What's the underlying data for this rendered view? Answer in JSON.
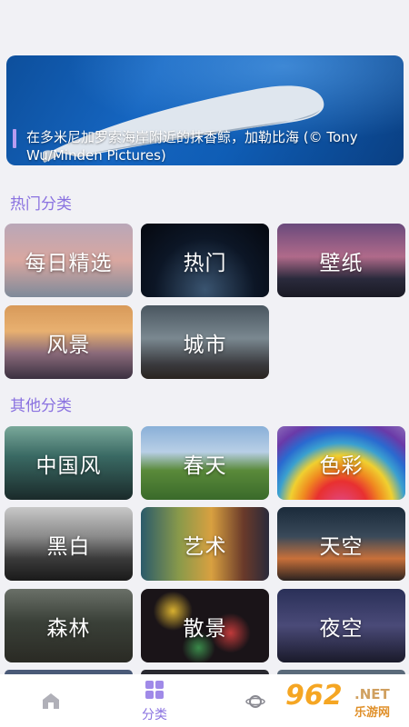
{
  "banner": {
    "caption": "在多米尼加罗索海岸附近的抹香鲸，加勒比海 (© Tony Wu/Minden Pictures)"
  },
  "sections": {
    "hot_title": "热门分类",
    "other_title": "其他分类"
  },
  "hot_categories": [
    {
      "label": "每日精选"
    },
    {
      "label": "热门"
    },
    {
      "label": "壁纸"
    },
    {
      "label": "风景"
    },
    {
      "label": "城市"
    }
  ],
  "other_categories": [
    {
      "label": "中国风"
    },
    {
      "label": "春天"
    },
    {
      "label": "色彩"
    },
    {
      "label": "黑白"
    },
    {
      "label": "艺术"
    },
    {
      "label": "天空"
    },
    {
      "label": "森林"
    },
    {
      "label": "散景"
    },
    {
      "label": "夜空"
    }
  ],
  "tabbar": {
    "home_icon": "home-icon",
    "category_label": "分类",
    "category_icon": "grid-icon",
    "third_icon": "planet-icon",
    "active_color": "#8a72e0"
  },
  "watermark": {
    "number": "962",
    "net": ".NET",
    "sub": "乐游网"
  }
}
